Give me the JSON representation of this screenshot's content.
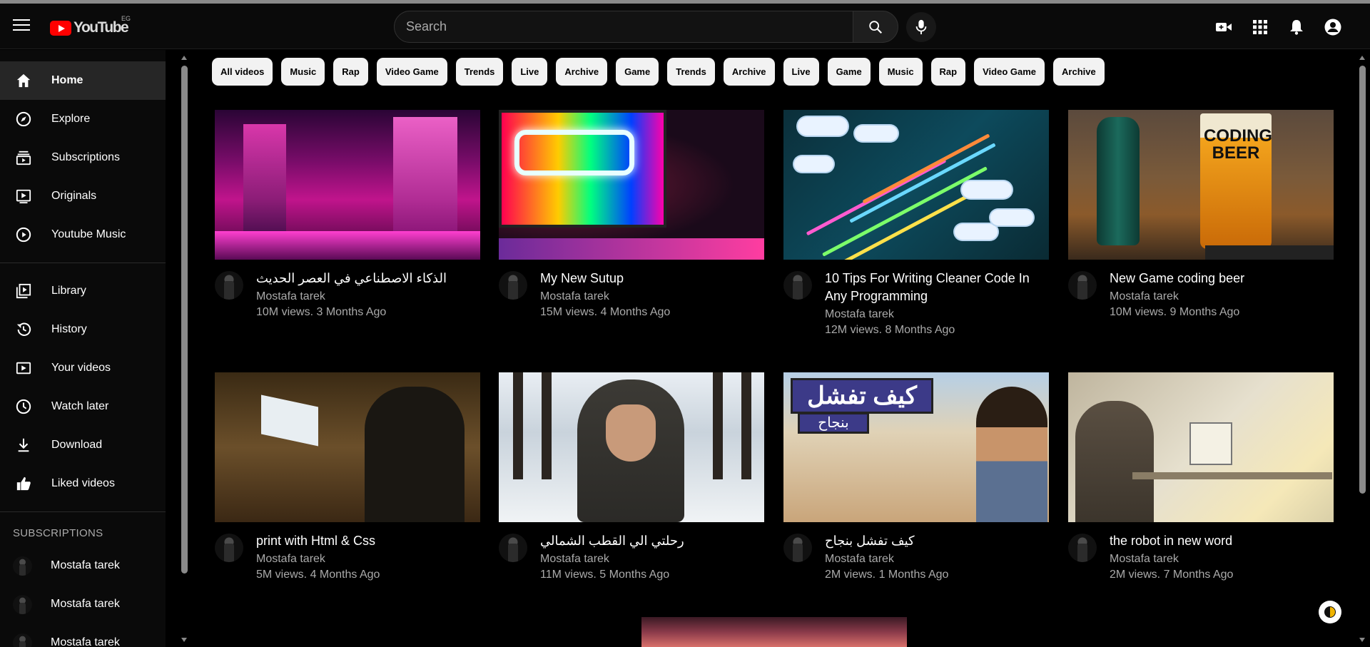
{
  "header": {
    "logo_text": "YouTube",
    "logo_region": "EG",
    "search_placeholder": "Search"
  },
  "sidebar": {
    "main_items": [
      {
        "label": "Home",
        "icon": "home-icon"
      },
      {
        "label": "Explore",
        "icon": "compass-icon"
      },
      {
        "label": "Subscriptions",
        "icon": "subscriptions-icon"
      },
      {
        "label": "Originals",
        "icon": "originals-icon"
      },
      {
        "label": "Youtube Music",
        "icon": "play-circle-icon"
      }
    ],
    "library_items": [
      {
        "label": "Library",
        "icon": "library-icon"
      },
      {
        "label": "History",
        "icon": "history-icon"
      },
      {
        "label": "Your videos",
        "icon": "your-videos-icon"
      },
      {
        "label": "Watch later",
        "icon": "clock-icon"
      },
      {
        "label": "Download",
        "icon": "download-icon"
      },
      {
        "label": "Liked videos",
        "icon": "thumbs-up-icon"
      }
    ],
    "subscriptions_title": "SUBSCRIPTIONS",
    "subscriptions": [
      "Mostafa tarek",
      "Mostafa tarek",
      "Mostafa tarek"
    ]
  },
  "chips": [
    "All videos",
    "Music",
    "Rap",
    "Video Game",
    "Trends",
    "Live",
    "Archive",
    "Game",
    "Trends",
    "Archive",
    "Live",
    "Game",
    "Music",
    "Rap",
    "Video Game",
    "Archive"
  ],
  "videos": [
    {
      "title": "الذكاء الاصطناعي في العصر الحديث",
      "channel": "Mostafa tarek",
      "stats": "10M views. 3 Months Ago"
    },
    {
      "title": "My New Sutup",
      "channel": "Mostafa tarek",
      "stats": "15M views. 4 Months Ago"
    },
    {
      "title": "10 Tips For Writing Cleaner Code In Any Programming",
      "channel": "Mostafa tarek",
      "stats": "12M views. 8 Months Ago"
    },
    {
      "title": "New Game coding beer",
      "channel": "Mostafa tarek",
      "stats": "10M views. 9 Months Ago"
    },
    {
      "title": "print with Html & Css",
      "channel": "Mostafa tarek",
      "stats": "5M views. 4 Months Ago"
    },
    {
      "title": "رحلتي الي القطب الشمالي",
      "channel": "Mostafa tarek",
      "stats": "11M views. 5 Months Ago"
    },
    {
      "title": "كيف تفشل بنجاح",
      "channel": "Mostafa tarek",
      "stats": "2M views. 1 Months Ago"
    },
    {
      "title": "the robot in new word",
      "channel": "Mostafa tarek",
      "stats": "2M views. 7 Months Ago"
    }
  ],
  "thumbnail_text": {
    "beer_sign": "CODING BEER",
    "fail_sign_line1": "كيف تفشل",
    "fail_sign_line2": "بنجاح"
  },
  "colors": {
    "accent": "#ff0000",
    "active_bg": "#262626",
    "chip_bg": "#f2f2f2"
  }
}
